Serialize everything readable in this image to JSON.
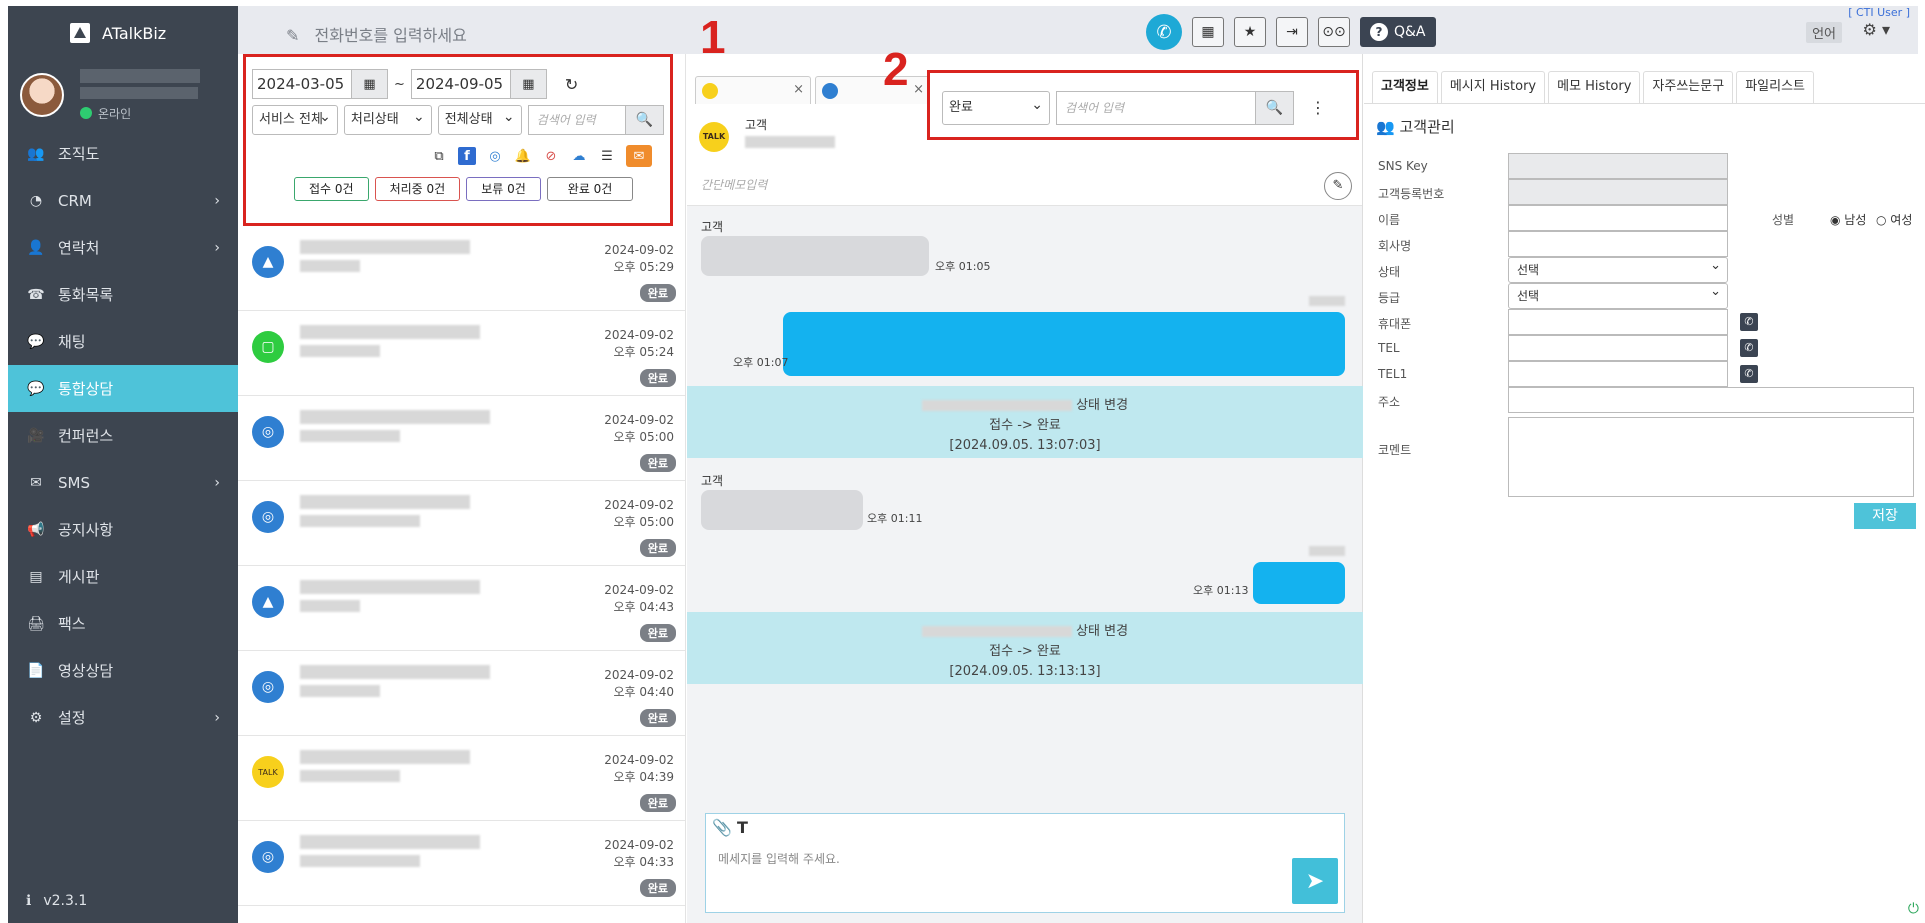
{
  "app": {
    "brand": "ATalkBiz",
    "status": "온라인",
    "version": "v2.3.1"
  },
  "sidebar": {
    "items": [
      {
        "label": "조직도",
        "icon": "users-icon",
        "glyph": "👥",
        "chevron": false,
        "active": false
      },
      {
        "label": "CRM",
        "icon": "gauge-icon",
        "glyph": "◔",
        "chevron": true,
        "active": false
      },
      {
        "label": "연락처",
        "icon": "person-icon",
        "glyph": "👤",
        "chevron": true,
        "active": false
      },
      {
        "label": "통화목록",
        "icon": "phone-book-icon",
        "glyph": "☎",
        "chevron": false,
        "active": false
      },
      {
        "label": "채팅",
        "icon": "chat-icon",
        "glyph": "💬",
        "chevron": false,
        "active": false
      },
      {
        "label": "통합상담",
        "icon": "chat-bubbles-icon",
        "glyph": "💬",
        "chevron": false,
        "active": true
      },
      {
        "label": "컨퍼런스",
        "icon": "video-icon",
        "glyph": "🎥",
        "chevron": false,
        "active": false
      },
      {
        "label": "SMS",
        "icon": "envelope-icon",
        "glyph": "✉",
        "chevron": true,
        "active": false
      },
      {
        "label": "공지사항",
        "icon": "megaphone-icon",
        "glyph": "📢",
        "chevron": false,
        "active": false
      },
      {
        "label": "게시판",
        "icon": "board-icon",
        "glyph": "▤",
        "chevron": false,
        "active": false
      },
      {
        "label": "팩스",
        "icon": "fax-icon",
        "glyph": "🖨",
        "chevron": false,
        "active": false
      },
      {
        "label": "영상상담",
        "icon": "document-icon",
        "glyph": "📄",
        "chevron": false,
        "active": false
      },
      {
        "label": "설정",
        "icon": "gear-icon",
        "glyph": "⚙",
        "chevron": true,
        "active": false
      }
    ]
  },
  "topbar": {
    "phone_placeholder": "전화번호를 입력하세요",
    "qa_label": "Q&A",
    "cti_user": "[ CTI User ]",
    "lang_label": "언어"
  },
  "filter": {
    "date_from": "2024-03-05",
    "date_sep": "~",
    "date_to": "2024-09-05",
    "service_select": "서비스 전체",
    "process_select": "처리상태",
    "all_status_select": "전체상태",
    "search_placeholder": "검색어 입력",
    "counts": [
      {
        "label": "접수 0건",
        "style": "green"
      },
      {
        "label": "처리중 0건",
        "style": "red"
      },
      {
        "label": "보류 0건",
        "style": "purple"
      },
      {
        "label": "완료 0건",
        "style": "gray"
      }
    ]
  },
  "annotations": {
    "one": "1",
    "two": "2"
  },
  "conversations": [
    {
      "channel": "atalk",
      "date": "2024-09-02",
      "time": "오후 05:29",
      "badge": "완료"
    },
    {
      "channel": "line",
      "date": "2024-09-02",
      "time": "오후 05:24",
      "badge": "완료"
    },
    {
      "channel": "headset",
      "date": "2024-09-02",
      "time": "오후 05:00",
      "badge": "완료"
    },
    {
      "channel": "headset",
      "date": "2024-09-02",
      "time": "오후 05:00",
      "badge": "완료"
    },
    {
      "channel": "atalk",
      "date": "2024-09-02",
      "time": "오후 04:43",
      "badge": "완료"
    },
    {
      "channel": "headset",
      "date": "2024-09-02",
      "time": "오후 04:40",
      "badge": "완료"
    },
    {
      "channel": "kakao",
      "date": "2024-09-02",
      "time": "오후 04:39",
      "badge": "완료"
    },
    {
      "channel": "headset",
      "date": "2024-09-02",
      "time": "오후 04:33",
      "badge": "완료"
    }
  ],
  "chat": {
    "customer_label": "고객",
    "kakao_text": "TALK",
    "status_select": "완료",
    "search_placeholder": "검색어 입력",
    "memo_placeholder": "간단메모입력",
    "compose_placeholder": "메세지를 입력해 주세요.",
    "messages": {
      "sender1": "고객",
      "time1": "오후 01:05",
      "time2": "오후 01:07",
      "status_change": "상태 변경",
      "status_transition": "접수 -> 완료",
      "status_time1": "[2024.09.05. 13:07:03]",
      "sender2": "고객",
      "time3": "오후 01:11",
      "time4": "오후 01:13",
      "status_change2": "상태 변경",
      "status_transition2": "접수 -> 완료",
      "status_time2": "[2024.09.05. 13:13:13]"
    }
  },
  "info": {
    "tabs": [
      "고객정보",
      "메시지 History",
      "메모 History",
      "자주쓰는문구",
      "파일리스트"
    ],
    "title": "고객관리",
    "labels": {
      "sns_key": "SNS Key",
      "reg_no": "고객등록번호",
      "name": "이름",
      "gender": "성별",
      "male": "남성",
      "female": "여성",
      "company": "회사명",
      "status": "상태",
      "grade": "등급",
      "mobile": "휴대폰",
      "tel": "TEL",
      "tel1": "TEL1",
      "address": "주소",
      "comment": "코멘트"
    },
    "status_value": "선택",
    "grade_value": "선택",
    "save_label": "저장"
  }
}
